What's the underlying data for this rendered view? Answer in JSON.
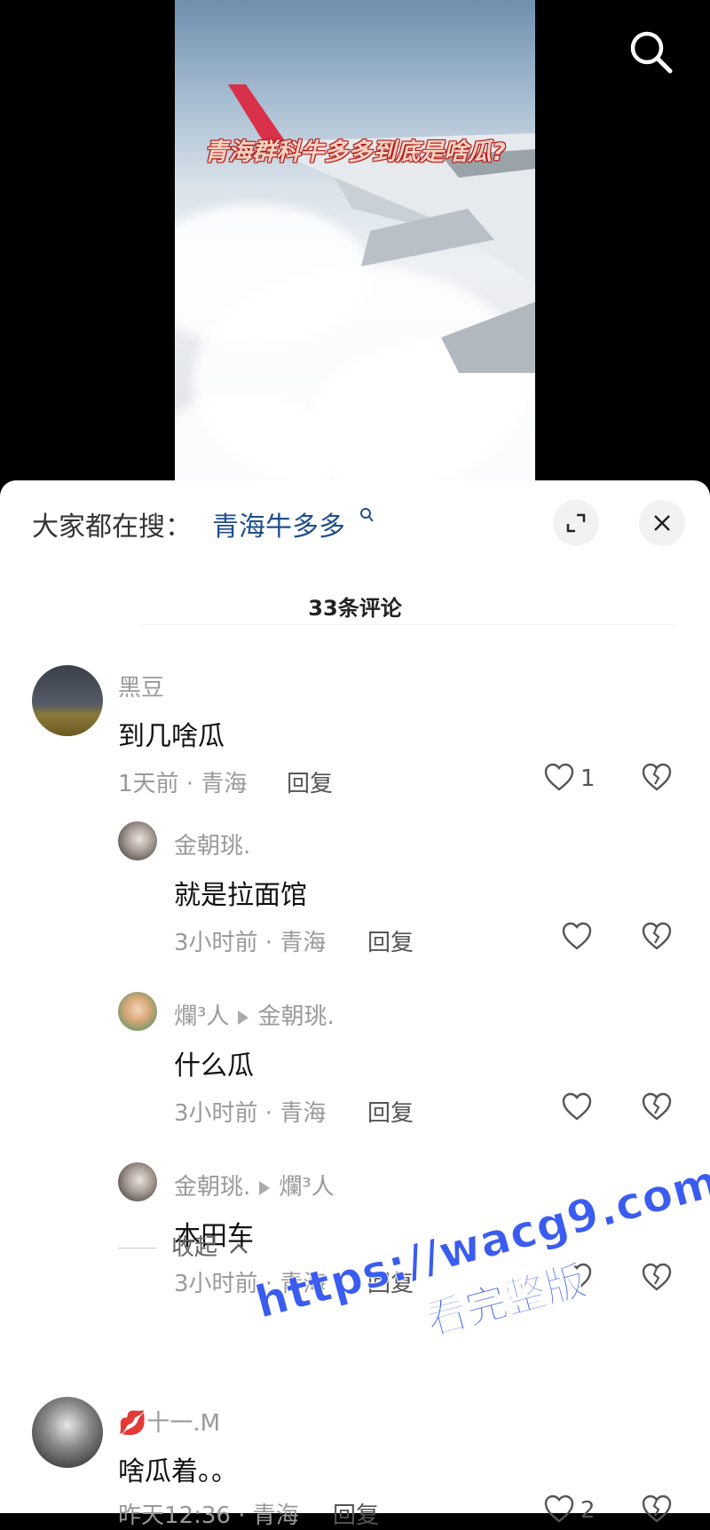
{
  "video": {
    "caption": "青海群科牛多多到底是啥瓜?"
  },
  "search_bar": {
    "label": "大家都在搜：",
    "term": "青海牛多多"
  },
  "comments_header": {
    "count_label": "33条评论"
  },
  "comments": [
    {
      "name": "黑豆",
      "text": "到几啥瓜",
      "meta": "1天前 · 青海",
      "reply_label": "回复",
      "likes": "1"
    },
    {
      "name": "金朝珧.",
      "text": "就是拉面馆",
      "meta": "3小时前 · 青海",
      "reply_label": "回复"
    },
    {
      "name": "爛³人",
      "reply_to": "金朝珧.",
      "text": "什么瓜",
      "meta": "3小时前 · 青海",
      "reply_label": "回复"
    },
    {
      "name": "金朝珧.",
      "reply_to": "爛³人",
      "text": "本田车",
      "meta": "3小时前 · 青海",
      "reply_label": "回复"
    },
    {
      "name": "十一.M",
      "text": "啥瓜着。。",
      "meta": "昨天12:36 · 青海",
      "reply_label": "回复",
      "likes": "2"
    }
  ],
  "collapse_label": "收起",
  "watermark": {
    "line1": "https://wacg9.com",
    "line2": "看完整版"
  },
  "colors": {
    "hot_term": "#1f4e8c",
    "watermark": "#3a5cf0"
  }
}
